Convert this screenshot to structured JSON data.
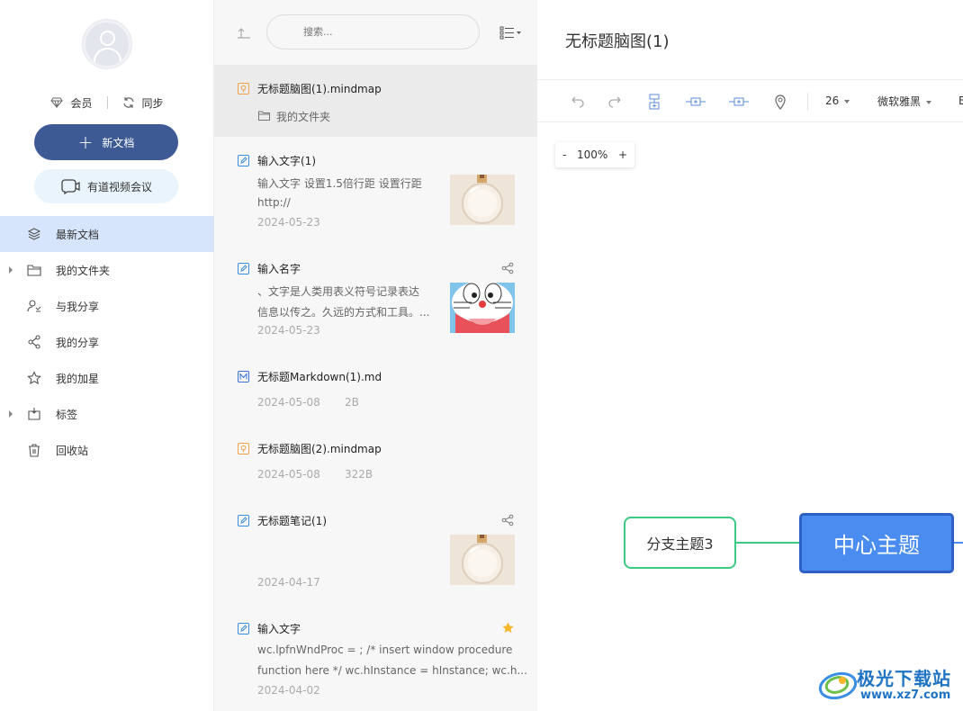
{
  "sidebar": {
    "member_label": "会员",
    "sync_label": "同步",
    "new_doc_label": "新文档",
    "video_meeting_label": "有道视频会议",
    "nav": [
      {
        "label": "最新文档",
        "icon": "layers-icon",
        "active": true,
        "expandable": false
      },
      {
        "label": "我的文件夹",
        "icon": "folder-icon",
        "active": false,
        "expandable": true
      },
      {
        "label": "与我分享",
        "icon": "shared-with-me-icon",
        "active": false,
        "expandable": false
      },
      {
        "label": "我的分享",
        "icon": "share-icon",
        "active": false,
        "expandable": false
      },
      {
        "label": "我的加星",
        "icon": "star-icon",
        "active": false,
        "expandable": false
      },
      {
        "label": "标签",
        "icon": "tag-icon",
        "active": false,
        "expandable": true
      },
      {
        "label": "回收站",
        "icon": "trash-icon",
        "active": false,
        "expandable": false
      }
    ]
  },
  "doclist": {
    "search_placeholder": "搜索...",
    "items": [
      {
        "title": "无标题脑图(1).mindmap",
        "icon": "mindmap-file-icon",
        "folder": "我的文件夹"
      },
      {
        "title": "输入文字(1)",
        "icon": "note-file-icon",
        "lines": [
          "输入文字 设置1.5倍行距 设置行距",
          "http://"
        ],
        "date": "2024-05-23",
        "thumb": "perfume-bottle"
      },
      {
        "title": "输入名字",
        "icon": "note-file-icon",
        "lines": [
          "、文字是人类用表义符号记录表达",
          "信息以传之。久远的方式和工具。..."
        ],
        "date": "2024-05-23",
        "thumb": "doraemon",
        "shared": true
      },
      {
        "title": "无标题Markdown(1).md",
        "icon": "markdown-file-icon",
        "date": "2024-05-08",
        "size": "2B"
      },
      {
        "title": "无标题脑图(2).mindmap",
        "icon": "mindmap-file-icon",
        "date": "2024-05-08",
        "size": "322B"
      },
      {
        "title": "无标题笔记(1)",
        "icon": "note-file-icon",
        "date": "2024-04-17",
        "thumb": "perfume-bottle",
        "shared": true
      },
      {
        "title": "输入文字",
        "icon": "note-file-icon",
        "lines": [
          "wc.lpfnWndProc = ; /* insert window procedure",
          "function here */ wc.hInstance = hInstance; wc.h..."
        ],
        "date": "2024-04-02",
        "starred": true
      }
    ]
  },
  "editor": {
    "title": "无标题脑图(1)",
    "font_size": "26",
    "font_name": "微软雅黑",
    "zoom_minus": "-",
    "zoom_level": "100%",
    "zoom_plus": "+",
    "branch_node": "分支主题3",
    "center_node": "中心主题"
  },
  "watermark": {
    "name": "极光下载站",
    "url": "www.xz7.com"
  },
  "colors": {
    "primary": "#3d5a95",
    "nav_active": "#d6e5fb",
    "center_node": "#4a8cf0",
    "branch_border": "#3cc983",
    "star": "#f7b52c",
    "mindmap_icon": "#f0a24a",
    "note_icon": "#3a8ee6"
  }
}
